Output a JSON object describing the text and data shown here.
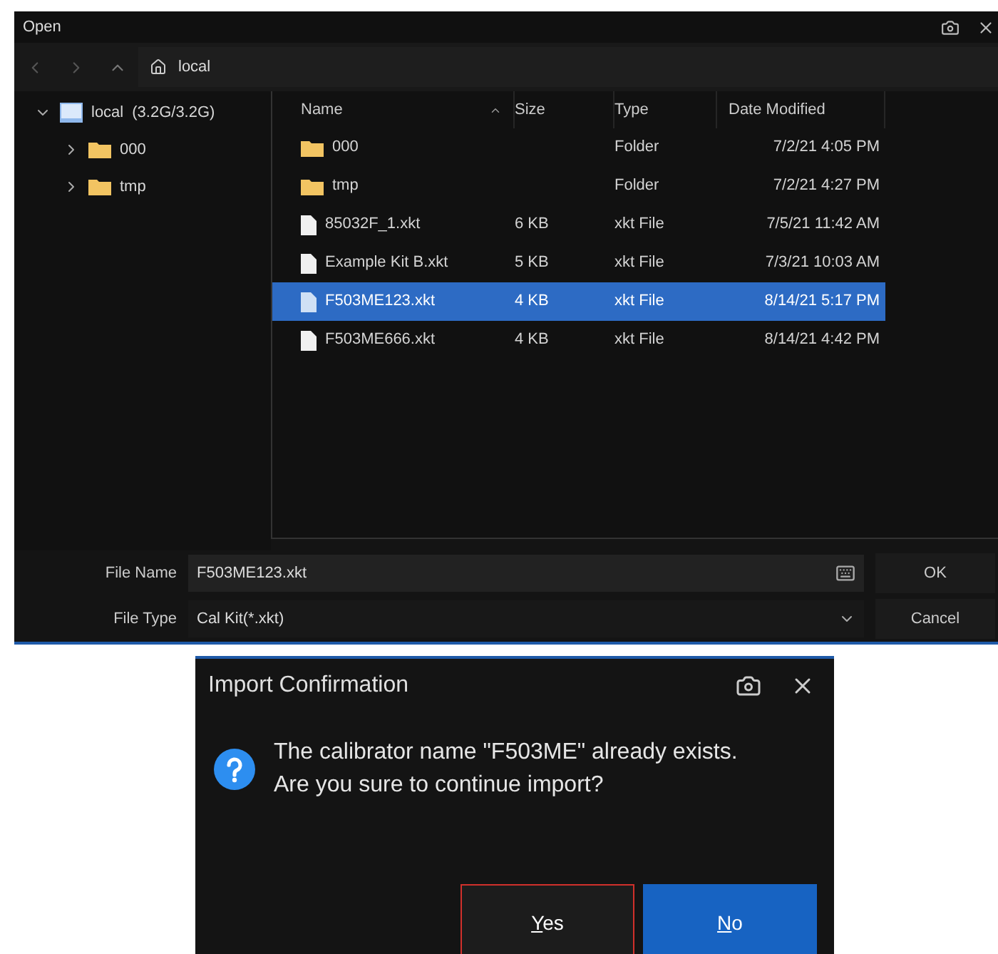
{
  "open_dialog": {
    "title": "Open",
    "path": "local",
    "tree": [
      {
        "label": "local",
        "capacity": "(3.2G/3.2G)",
        "kind": "drive",
        "expanded": true,
        "children": [
          {
            "label": "000",
            "kind": "folder",
            "expanded": false
          },
          {
            "label": "tmp",
            "kind": "folder",
            "expanded": false
          }
        ]
      }
    ],
    "table": {
      "columns": [
        {
          "label": "Name",
          "sorted": true
        },
        {
          "label": "Size",
          "sorted": false
        },
        {
          "label": "Type",
          "sorted": false
        },
        {
          "label": "Date Modified",
          "sorted": false
        }
      ],
      "rows": [
        {
          "kind": "folder",
          "name": "000",
          "size": "",
          "type": "Folder",
          "date": "7/2/21 4:05 PM",
          "selected": false
        },
        {
          "kind": "folder",
          "name": "tmp",
          "size": "",
          "type": "Folder",
          "date": "7/2/21 4:27 PM",
          "selected": false
        },
        {
          "kind": "file",
          "name": "85032F_1.xkt",
          "size": "6 KB",
          "type": "xkt File",
          "date": "7/5/21 11:42 AM",
          "selected": false
        },
        {
          "kind": "file",
          "name": "Example Kit B.xkt",
          "size": "5 KB",
          "type": "xkt File",
          "date": "7/3/21 10:03 AM",
          "selected": false
        },
        {
          "kind": "file",
          "name": "F503ME123.xkt",
          "size": "4 KB",
          "type": "xkt File",
          "date": "8/14/21 5:17 PM",
          "selected": true
        },
        {
          "kind": "file",
          "name": "F503ME666.xkt",
          "size": "4 KB",
          "type": "xkt File",
          "date": "8/14/21 4:42 PM",
          "selected": false
        }
      ]
    },
    "file_name": {
      "label": "File Name",
      "value": "F503ME123.xkt"
    },
    "file_type": {
      "label": "File Type",
      "value": "Cal Kit(*.xkt)"
    },
    "buttons": [
      "OK",
      "Cancel"
    ]
  },
  "confirm_dialog": {
    "title": "Import Confirmation",
    "message": [
      "The calibrator name \"F503ME\" already exists.",
      "Are you sure to continue import?"
    ],
    "buttons": [
      {
        "label": "Yes",
        "focused": true,
        "primary": false
      },
      {
        "label": "No",
        "focused": false,
        "primary": true
      }
    ]
  }
}
